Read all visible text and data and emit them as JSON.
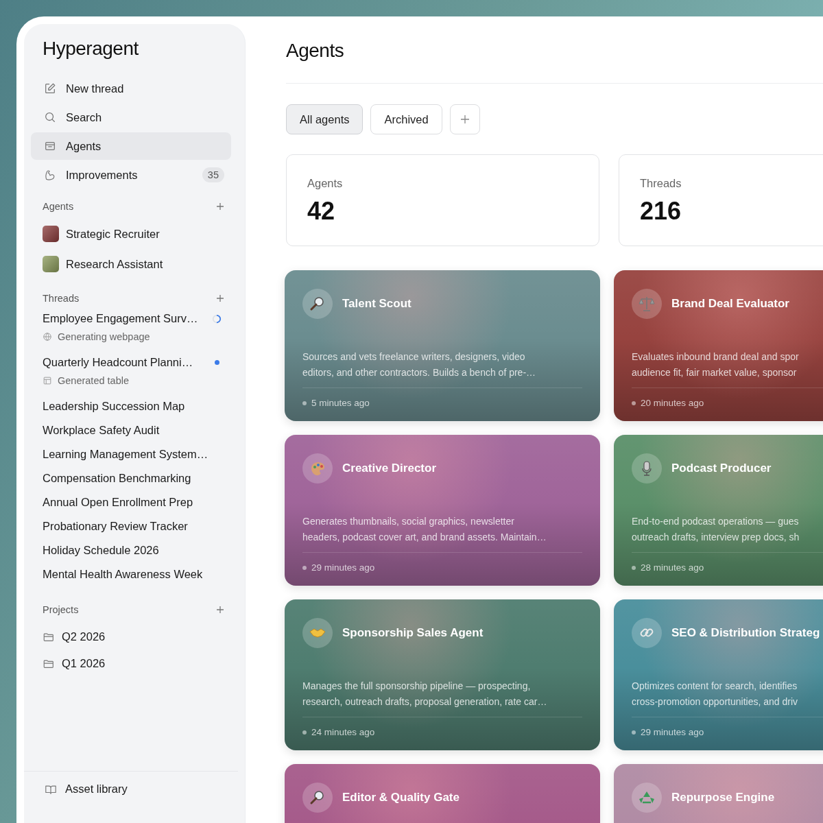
{
  "sidebar": {
    "brand": "Hyperagent",
    "nav": [
      {
        "label": "New thread",
        "selected": false
      },
      {
        "label": "Search",
        "selected": false
      },
      {
        "label": "Agents",
        "selected": true
      },
      {
        "label": "Improvements",
        "selected": false,
        "badge": "35"
      }
    ],
    "agents_section": {
      "title": "Agents",
      "items": [
        {
          "label": "Strategic Recruiter",
          "color": "#8a3a3a"
        },
        {
          "label": "Research Assistant",
          "color": "#8a9a5a"
        }
      ]
    },
    "threads_section": {
      "title": "Threads",
      "items": [
        {
          "label": "Employee Engagement Surv…",
          "running": true,
          "detail": {
            "kind": "webpage",
            "text": "Generating webpage"
          }
        },
        {
          "label": "Quarterly Headcount Planni…",
          "unread": true,
          "detail": {
            "kind": "table",
            "text": "Generated table"
          }
        },
        {
          "label": "Leadership Succession Map"
        },
        {
          "label": "Workplace Safety Audit"
        },
        {
          "label": "Learning Management System…"
        },
        {
          "label": "Compensation Benchmarking"
        },
        {
          "label": "Annual Open Enrollment Prep"
        },
        {
          "label": "Probationary Review Tracker"
        },
        {
          "label": "Holiday Schedule 2026"
        },
        {
          "label": "Mental Health Awareness Week"
        }
      ]
    },
    "projects_section": {
      "title": "Projects",
      "items": [
        {
          "label": "Q2 2026"
        },
        {
          "label": "Q1 2026"
        }
      ]
    },
    "footer": {
      "label": "Asset library"
    }
  },
  "main": {
    "title": "Agents",
    "tabs": [
      {
        "label": "All agents",
        "selected": true
      },
      {
        "label": "Archived",
        "selected": false
      }
    ],
    "stats": [
      {
        "label": "Agents",
        "value": "42"
      },
      {
        "label": "Threads",
        "value": "216"
      }
    ],
    "cards": [
      {
        "title": "Talent Scout",
        "color": "#6b8d90",
        "description_lines": [
          "Sources and vets freelance writers, designers, video",
          "editors, and other contractors. Builds a bench of pre-…"
        ],
        "time": "5 minutes ago"
      },
      {
        "title": "Brand Deal Evaluator",
        "color": "#97433f",
        "description_lines": [
          "Evaluates inbound brand deal and spor",
          "audience fit, fair market value, sponsor"
        ],
        "time": "20 minutes ago"
      },
      {
        "title": "Creative Director",
        "color": "#a0659a",
        "description_lines": [
          "Generates thumbnails, social graphics, newsletter",
          "headers, podcast cover art, and brand assets. Maintain…"
        ],
        "time": "29 minutes ago"
      },
      {
        "title": "Podcast Producer",
        "color": "#5b906a",
        "description_lines": [
          "End-to-end podcast operations — gues",
          "outreach drafts, interview prep docs, sh"
        ],
        "time": "28 minutes ago"
      },
      {
        "title": "Sponsorship Sales Agent",
        "color": "#4f7d70",
        "description_lines": [
          "Manages the full sponsorship pipeline — prospecting,",
          "research, outreach drafts, proposal generation, rate car…"
        ],
        "time": "24 minutes ago"
      },
      {
        "title": "SEO & Distribution Strateg",
        "color": "#4a8f9c",
        "description_lines": [
          "Optimizes content for search, identifies",
          "cross-promotion opportunities, and driv"
        ],
        "time": "29 minutes ago"
      },
      {
        "title": "Editor & Quality Gate",
        "color": "#a55a8a"
      },
      {
        "title": "Repurpose Engine",
        "color": "#b08ba4"
      }
    ]
  }
}
